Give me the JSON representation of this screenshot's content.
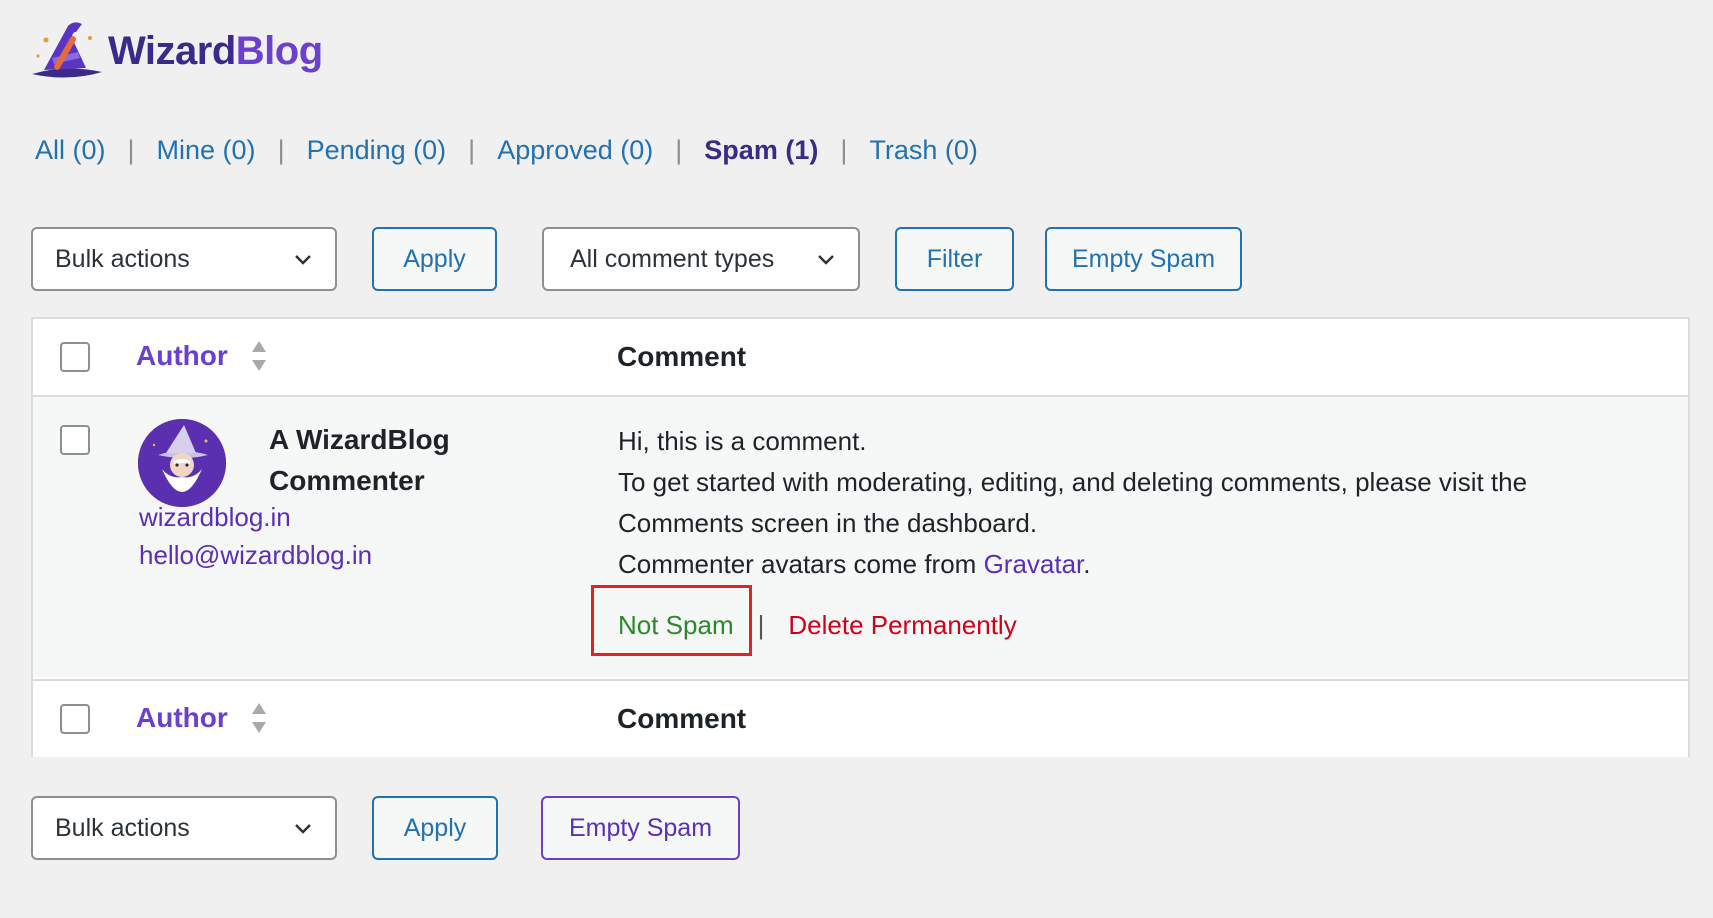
{
  "brand": {
    "name_part1": "Wizard",
    "name_part2": "Blog"
  },
  "filters": [
    {
      "label": "All (0)",
      "current": false
    },
    {
      "label": "Mine (0)",
      "current": false
    },
    {
      "label": "Pending (0)",
      "current": false
    },
    {
      "label": "Approved (0)",
      "current": false
    },
    {
      "label": "Spam (1)",
      "current": true
    },
    {
      "label": "Trash (0)",
      "current": false
    }
  ],
  "filter_separator": "|",
  "top_nav": {
    "bulk_actions": "Bulk actions",
    "apply": "Apply",
    "comment_types": "All comment types",
    "filter": "Filter",
    "empty_spam": "Empty Spam"
  },
  "table": {
    "col_author": "Author",
    "col_comment": "Comment"
  },
  "comment": {
    "author_name": "A WizardBlog Commenter",
    "author_url": "wizardblog.in",
    "author_email": "hello@wizardblog.in",
    "line1": "Hi, this is a comment.",
    "line2": "To get started with moderating, editing, and deleting comments, please visit the Comments screen in the dashboard.",
    "line3_prefix": "Commenter avatars come from ",
    "line3_link": "Gravatar",
    "line3_suffix": "."
  },
  "row_actions": {
    "not_spam": "Not Spam",
    "separator": "|",
    "delete": "Delete Permanently"
  },
  "bottom_nav": {
    "bulk_actions": "Bulk actions",
    "apply": "Apply",
    "empty_spam": "Empty Spam"
  },
  "colors": {
    "link": "#2271b1",
    "brand": "#6b3fd0",
    "not_spam": "#2a8a2a",
    "delete": "#d0021b",
    "highlight": "#e02424"
  }
}
